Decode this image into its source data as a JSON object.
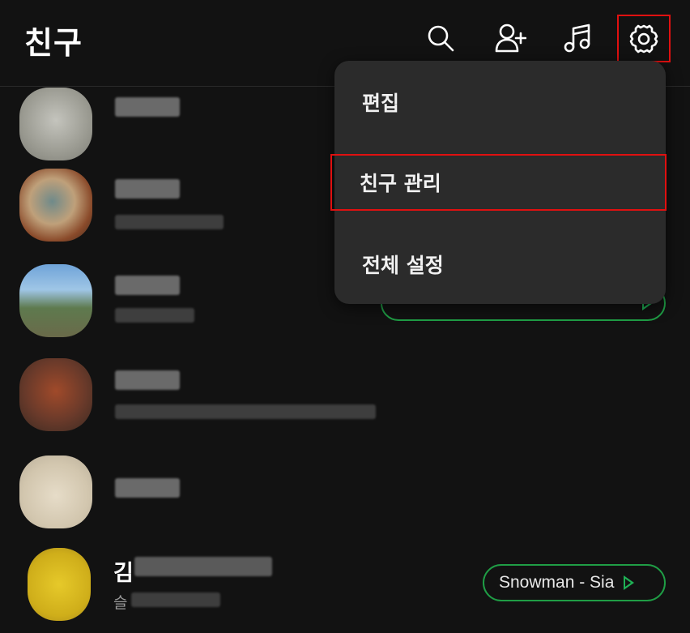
{
  "header": {
    "title": "친구",
    "icons": [
      "search-icon",
      "add-friend-icon",
      "music-icon",
      "settings-icon"
    ]
  },
  "friends": [
    {
      "name": "",
      "status": "",
      "music": ""
    },
    {
      "name": "",
      "status": "",
      "music": ""
    },
    {
      "name": "",
      "status": "",
      "music": ""
    },
    {
      "name": "",
      "status": "",
      "music": ""
    },
    {
      "name": "",
      "status": "",
      "music": ""
    },
    {
      "name_visible": "김",
      "status_visible": "슬",
      "music": "Snowman - Sia"
    }
  ],
  "menu": {
    "items": [
      {
        "label": "편집"
      },
      {
        "label": "친구 관리"
      },
      {
        "label": "전체 설정"
      }
    ]
  },
  "colors": {
    "background": "#121212",
    "menu_bg": "#2b2b2b",
    "music_pill_border": "#1f9d45",
    "highlight": "#e01010"
  }
}
